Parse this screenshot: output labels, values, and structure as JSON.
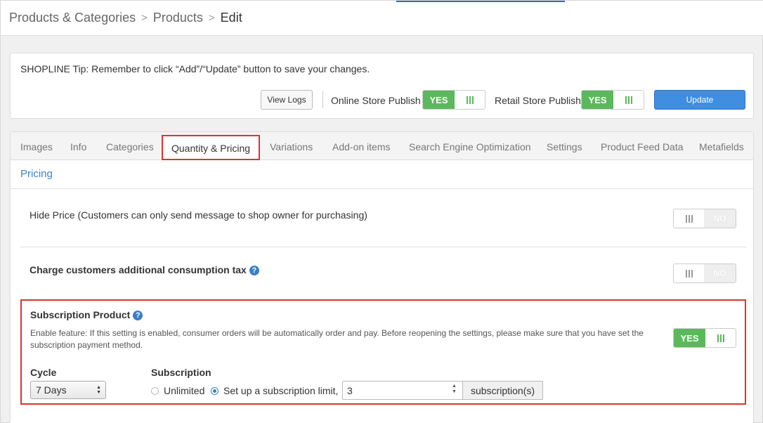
{
  "breadcrumb": {
    "items": [
      "Products & Categories",
      "Products"
    ],
    "current": "Edit",
    "separator": ">"
  },
  "tip": {
    "text": "SHOPLINE Tip: Remember to click “Add”/“Update” button to save your changes."
  },
  "actions": {
    "view_logs_label": "View Logs",
    "online_store_label": "Online Store Publish",
    "online_store_state": "YES",
    "retail_store_label": "Retail Store Publish",
    "retail_store_state": "YES",
    "update_label": "Update"
  },
  "tabs": [
    {
      "label": "Images",
      "active": false
    },
    {
      "label": "Info",
      "active": false
    },
    {
      "label": "Categories",
      "active": false
    },
    {
      "label": "Quantity & Pricing",
      "active": true
    },
    {
      "label": "Variations",
      "active": false
    },
    {
      "label": "Add-on items",
      "active": false
    },
    {
      "label": "Search Engine Optimization",
      "active": false
    },
    {
      "label": "Settings",
      "active": false
    },
    {
      "label": "Product Feed Data",
      "active": false
    },
    {
      "label": "Metafields",
      "active": false
    }
  ],
  "pricing": {
    "section_title": "Pricing",
    "hide_price": {
      "label": "Hide Price (Customers can only send message to shop owner for purchasing)",
      "state": "NO"
    },
    "consumption_tax": {
      "label": "Charge customers additional consumption tax",
      "state": "NO"
    },
    "subscription": {
      "title": "Subscription Product",
      "description": "Enable feature: If this setting is enabled, consumer orders will be automatically order and pay. Before reopening the settings, please make sure that you have set the subscription payment method.",
      "state": "YES",
      "cycle_label": "Cycle",
      "cycle_value": "7 Days",
      "subscription_label": "Subscription",
      "option_unlimited": "Unlimited",
      "option_limit": "Set up a subscription limit,",
      "limit_value": "3",
      "limit_suffix": "subscription(s)"
    }
  },
  "colors": {
    "toggle_on": "#5cb85c",
    "primary_button": "#3f8ee0",
    "highlight_border": "#d9352f",
    "link": "#3a84c9"
  },
  "icons": [
    "help-icon",
    "grip-icon",
    "chevron-right-icon",
    "select-arrows-icon",
    "spinner-icon"
  ]
}
